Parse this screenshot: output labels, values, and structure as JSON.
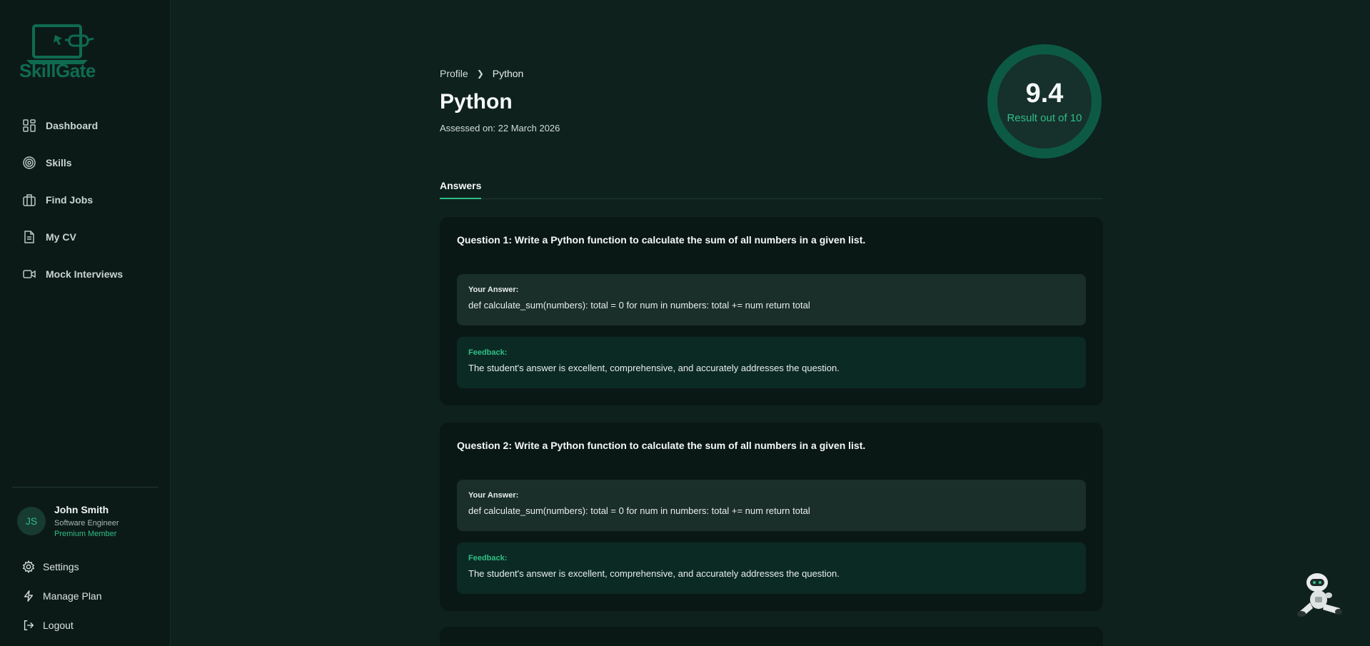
{
  "brand": {
    "name": "SkillGate",
    "accent": "#2fbf85",
    "logo_color": "#0f6b50"
  },
  "sidebar": {
    "items": [
      {
        "label": "Dashboard",
        "icon": "dashboard-icon"
      },
      {
        "label": "Skills",
        "icon": "target-icon"
      },
      {
        "label": "Find Jobs",
        "icon": "briefcase-icon"
      },
      {
        "label": "My CV",
        "icon": "document-icon"
      },
      {
        "label": "Mock Interviews",
        "icon": "video-icon"
      }
    ],
    "user": {
      "initials": "JS",
      "name": "John Smith",
      "role": "Software Engineer",
      "plan": "Premium Member"
    },
    "bottom": [
      {
        "label": "Settings",
        "icon": "gear-icon"
      },
      {
        "label": "Manage Plan",
        "icon": "lightning-icon"
      },
      {
        "label": "Logout",
        "icon": "logout-icon"
      }
    ]
  },
  "breadcrumb": {
    "parent": "Profile",
    "current": "Python"
  },
  "page": {
    "title": "Python",
    "assessed": "Assessed on: 22 March 2026"
  },
  "score": {
    "value": "9.4",
    "label": "Result out of 10"
  },
  "tabs": [
    {
      "label": "Answers",
      "active": true
    }
  ],
  "questions": [
    {
      "title": "Question 1: Write a Python function to calculate the sum of all numbers in a given list.",
      "answer_label": "Your Answer:",
      "answer": "def calculate_sum(numbers): total = 0 for num in numbers: total += num return total",
      "feedback_label": "Feedback:",
      "feedback": "The student's answer is excellent, comprehensive, and accurately addresses the question."
    },
    {
      "title": "Question 2: Write a Python function to calculate the sum of all numbers in a given list.",
      "answer_label": "Your Answer:",
      "answer": "def calculate_sum(numbers): total = 0 for num in numbers: total += num return total",
      "feedback_label": "Feedback:",
      "feedback": "The student's answer is excellent, comprehensive, and accurately addresses the question."
    }
  ],
  "assistant": {
    "icon": "robot-assistant-icon"
  }
}
